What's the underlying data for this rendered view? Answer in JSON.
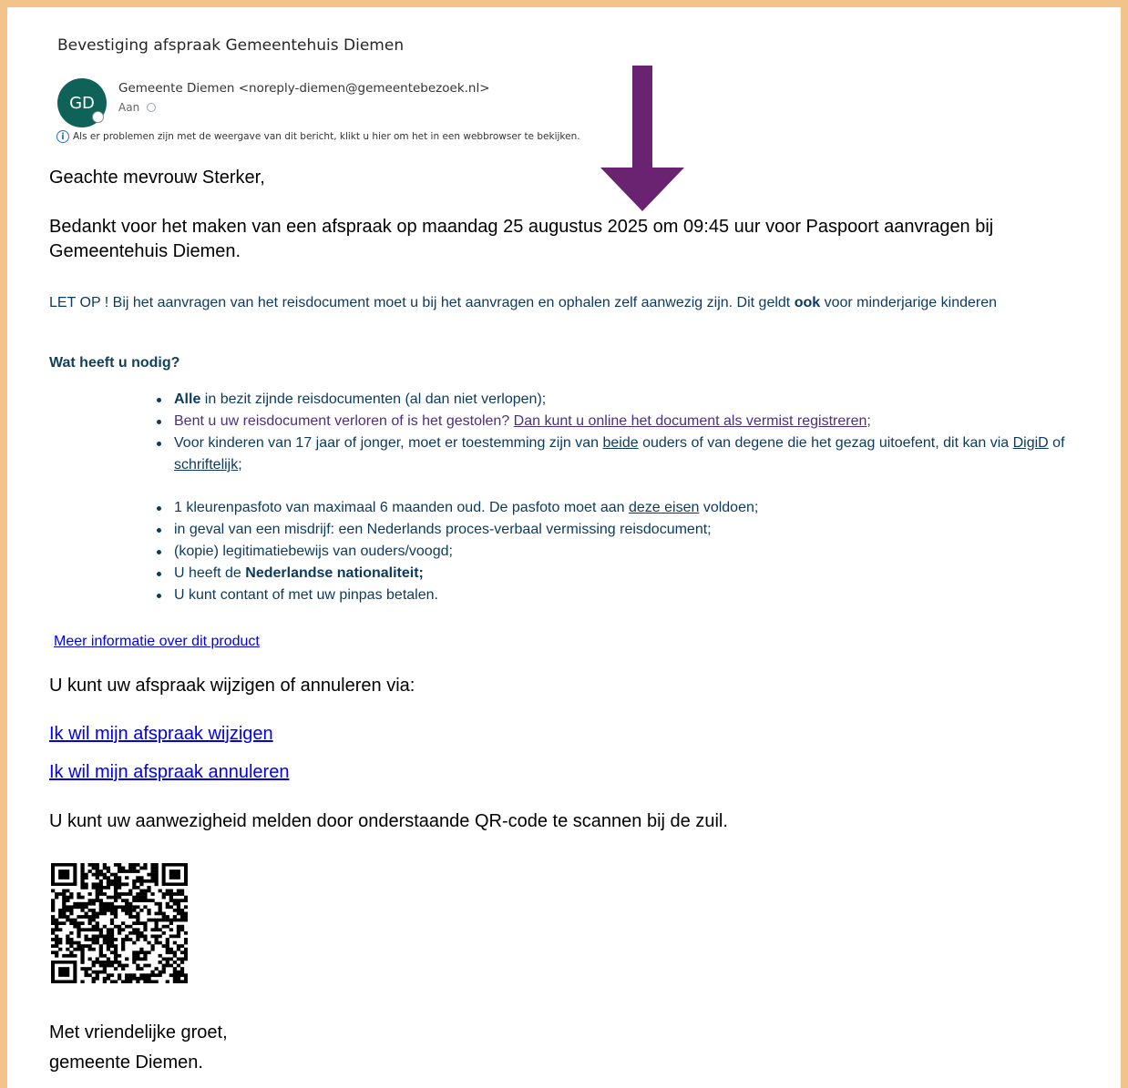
{
  "email": {
    "subject": "Bevestiging afspraak Gemeentehuis Diemen",
    "avatar_initials": "GD",
    "sender": "Gemeente Diemen <noreply-diemen@gemeentebezoek.nl>",
    "to_label": "Aan",
    "info_bar": "Als er problemen zijn met de weergave van dit bericht, klikt u hier om het in een webbrowser te bekijken."
  },
  "body": {
    "greeting": "Geachte mevrouw Sterker,",
    "intro": "Bedankt voor het maken van een afspraak op maandag 25 augustus 2025 om 09:45 uur voor Paspoort aanvragen bij Gemeentehuis Diemen.",
    "let_op_prefix": "LET OP ! Bij het aanvragen van het reisdocument moet u bij het aanvragen en ophalen zelf aanwezig zijn. Dit geldt ",
    "let_op_bold": "ook",
    "let_op_suffix": " voor minderjarige kinderen",
    "need_title": "Wat heeft u nodig?",
    "req_1_bold": "Alle",
    "req_1_text": " in bezit zijnde reisdocumenten (al dan niet verlopen);",
    "req_2_text": "Bent u uw reisdocument verloren of is het gestolen? ",
    "req_2_link": "Dan kunt u online het document als vermist registreren",
    "req_2_end": ";",
    "req_3_text_a": "Voor kinderen van 17 jaar of jonger, moet er toestemming zijn van ",
    "req_3_link_a": "beide",
    "req_3_text_b": " ouders of van degene die het gezag uitoefent, dit kan via ",
    "req_3_link_b": "DigiD",
    "req_3_text_c": " of ",
    "req_3_link_c": "schriftelijk",
    "req_3_end": ";",
    "req_4_text": "1 kleurenpasfoto van maximaal 6 maanden oud. De pasfoto moet aan ",
    "req_4_link": "deze eisen",
    "req_4_end": " voldoen;",
    "req_5_text": "in geval van een misdrijf: een Nederlands proces-verbaal vermissing reisdocument;",
    "req_6_text": " (kopie) legitimatiebewijs van ouders/voogd;",
    "req_7_text": "U heeft de ",
    "req_7_bold": "Nederlandse nationaliteit;",
    "req_8_text": "U kunt contant of met uw pinpas betalen.",
    "more_info": "Meer informatie over dit product",
    "change_text": "U kunt uw afspraak wijzigen of annuleren via:",
    "link_change": "Ik wil mijn afspraak wijzigen",
    "link_cancel": "Ik wil mijn afspraak annuleren",
    "qr_text": "U kunt uw aanwezigheid melden door onderstaande QR-code te scannen bij de zuil.",
    "closing_1": "Met vriendelijke groet,",
    "closing_2": "gemeente Diemen."
  },
  "colors": {
    "frame": "#f2c48c",
    "avatar": "#0e6258",
    "arrow": "#6a2370",
    "teal_text": "#0b3a5e",
    "link": "#0000ee"
  }
}
